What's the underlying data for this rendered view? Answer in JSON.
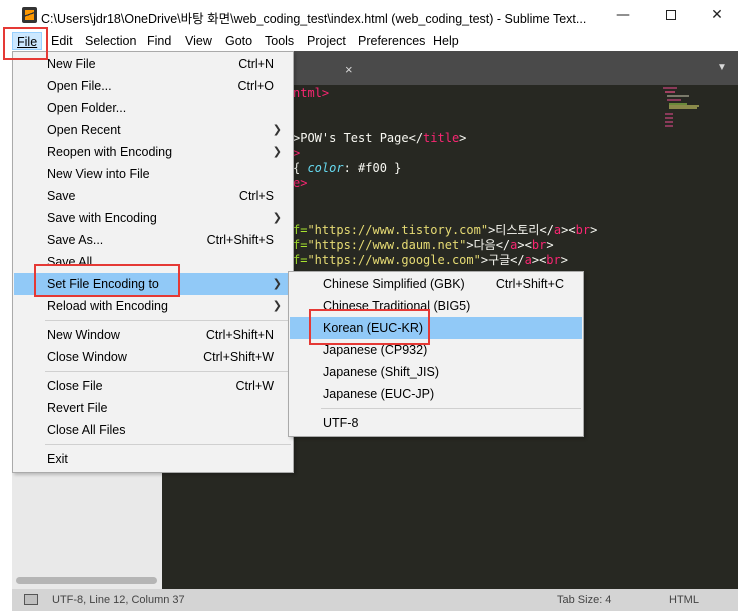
{
  "window": {
    "title": "C:\\Users\\jdr18\\OneDrive\\바탕 화면\\web_coding_test\\index.html (web_coding_test) - Sublime Text...",
    "minimize": "—",
    "close": "✕"
  },
  "menubar": {
    "file": "File",
    "edit": "Edit",
    "selection": "Selection",
    "find": "Find",
    "view": "View",
    "goto": "Goto",
    "tools": "Tools",
    "project": "Project",
    "preferences": "Preferences",
    "help": "Help"
  },
  "file_menu": {
    "new_file": {
      "label": "New File",
      "shortcut": "Ctrl+N"
    },
    "open_file": {
      "label": "Open File...",
      "shortcut": "Ctrl+O"
    },
    "open_folder": {
      "label": "Open Folder..."
    },
    "open_recent": {
      "label": "Open Recent"
    },
    "reopen_with_encoding": {
      "label": "Reopen with Encoding"
    },
    "new_view_into_file": {
      "label": "New View into File"
    },
    "save": {
      "label": "Save",
      "shortcut": "Ctrl+S"
    },
    "save_with_encoding": {
      "label": "Save with Encoding"
    },
    "save_as": {
      "label": "Save As...",
      "shortcut": "Ctrl+Shift+S"
    },
    "save_all": {
      "label": "Save All"
    },
    "set_file_encoding_to": {
      "label": "Set File Encoding to"
    },
    "reload_with_encoding": {
      "label": "Reload with Encoding"
    },
    "new_window": {
      "label": "New Window",
      "shortcut": "Ctrl+Shift+N"
    },
    "close_window": {
      "label": "Close Window",
      "shortcut": "Ctrl+Shift+W"
    },
    "close_file": {
      "label": "Close File",
      "shortcut": "Ctrl+W"
    },
    "revert_file": {
      "label": "Revert File"
    },
    "close_all_files": {
      "label": "Close All Files"
    },
    "exit": {
      "label": "Exit"
    }
  },
  "encoding_menu": {
    "chinese_simplified": {
      "label": "Chinese Simplified (GBK)",
      "shortcut": "Ctrl+Shift+C"
    },
    "chinese_traditional": {
      "label": "Chinese Traditional (BIG5)"
    },
    "korean": {
      "label": "Korean (EUC-KR)"
    },
    "japanese_cp932": {
      "label": "Japanese (CP932)"
    },
    "japanese_shift_jis": {
      "label": "Japanese (Shift_JIS)"
    },
    "japanese_euc_jp": {
      "label": "Japanese (EUC-JP)"
    },
    "utf8": {
      "label": "UTF-8"
    }
  },
  "editor": {
    "tab_close": "×",
    "tab_dropdown": "▼",
    "lines": {
      "l1": "ntml>",
      "l2a": ">POW's Test Page</",
      "l2b": "title",
      "l2c": ">",
      "l3a": ">",
      "l4a": "{ ",
      "l4b": "color",
      "l4c": ": ",
      "l4d": "#f00",
      "l4e": " }",
      "l5a": "e>",
      "l6a": "f=",
      "l6b": "\"https://www.tistory.com\"",
      "l6c": ">티스토리</",
      "l6d": "a",
      "l6e": "><",
      "l6f": "br",
      "l6g": ">",
      "l7a": "f=",
      "l7b": "\"https://www.daum.net\"",
      "l7c": ">다음</",
      "l7d": "a",
      "l7e": "><",
      "l7f": "br",
      "l7g": ">",
      "l8a": "f=",
      "l8b": "\"https://www.google.com\"",
      "l8c": ">구글</",
      "l8d": "a",
      "l8e": "><",
      "l8f": "br",
      "l8g": ">"
    }
  },
  "statusbar": {
    "position": "UTF-8, Line 12, Column 37",
    "tab_size": "Tab Size: 4",
    "syntax": "HTML"
  },
  "colors": {
    "editor_bg": "#272822",
    "menu_highlight": "#91c9f7",
    "annotation_red": "#e53935"
  }
}
